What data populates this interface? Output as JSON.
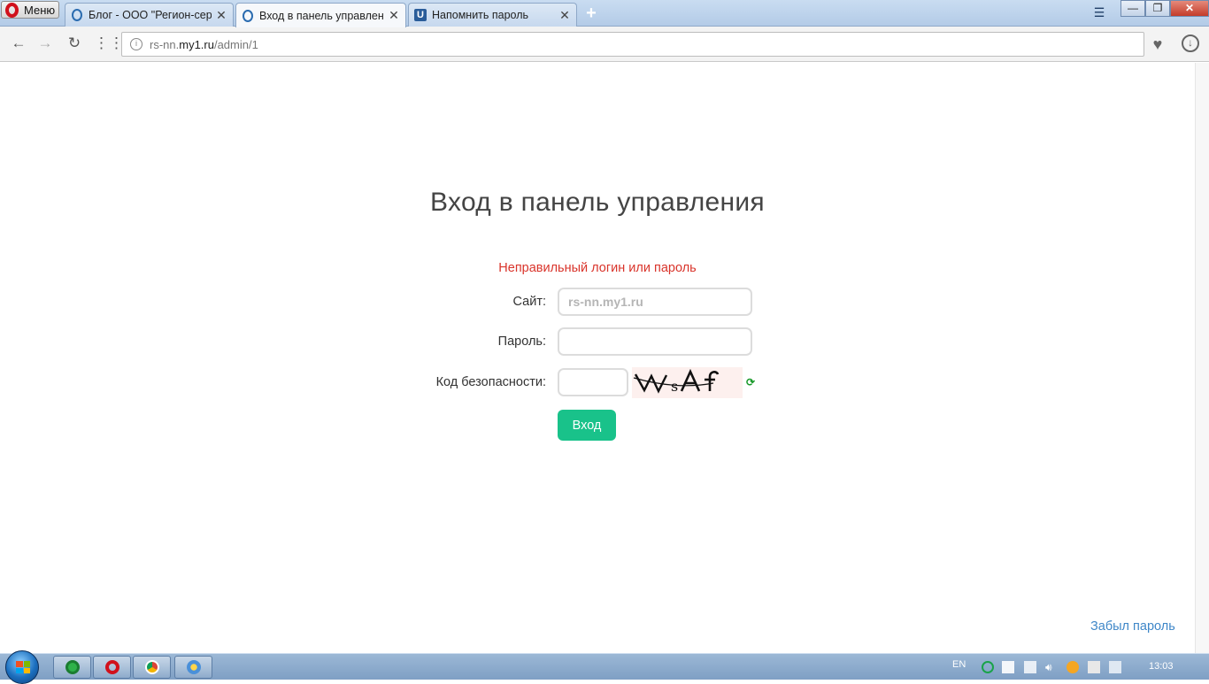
{
  "browser": {
    "menu_label": "Меню",
    "tabs": [
      {
        "title": "Блог - ООО \"Регион-серв",
        "active": false
      },
      {
        "title": "Вход в панель управлени",
        "active": true
      },
      {
        "title": "Напомнить пароль",
        "active": false
      }
    ],
    "new_tab_symbol": "+",
    "close_symbol": "✕",
    "window_controls": {
      "minimize": "—",
      "restore": "❐",
      "close": "✕"
    },
    "url": {
      "prefix": "rs-nn.",
      "host": "my1.ru",
      "path": "/admin/1"
    },
    "icons": [
      "back-icon",
      "forward-icon",
      "reload-icon",
      "speed-dial-icon",
      "site-info-icon",
      "heart-icon",
      "download-icon"
    ]
  },
  "page": {
    "title": "Вход в панель управления",
    "error": "Неправильный логин или пароль",
    "fields": {
      "site_label": "Сайт:",
      "site_value": "rs-nn.my1.ru",
      "password_label": "Пароль:",
      "password_value": "",
      "captcha_label": "Код безопасности:",
      "captcha_value": ""
    },
    "captcha_text": "VWsAf",
    "submit_label": "Вход",
    "forgot_link": "Забыл пароль"
  },
  "taskbar": {
    "language": "EN",
    "clock": "13:03",
    "apps": [
      "opera-web-browser-icon",
      "opera-icon",
      "chrome-icon",
      "paint-icon"
    ]
  },
  "colors": {
    "error": "#d9342b",
    "submit": "#19c28a",
    "link": "#3f87c8",
    "captcha_bg": "#fdf0ee"
  }
}
